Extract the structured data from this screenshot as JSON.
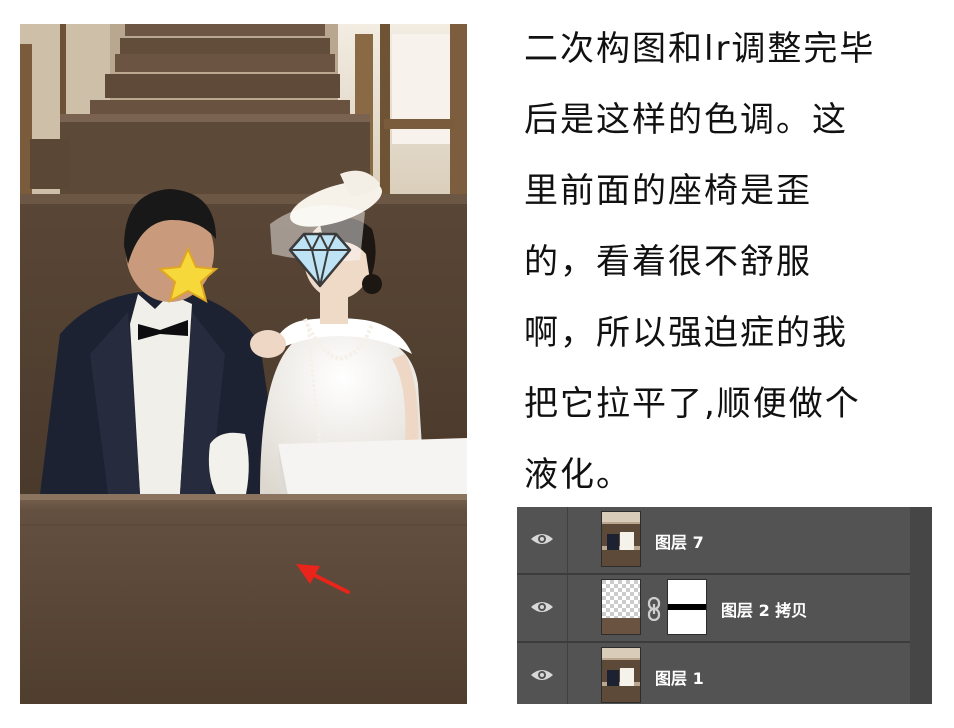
{
  "caption": {
    "lines": [
      "二次构图和lr调整完毕",
      "后是这样的色调。这",
      "里前面的座椅是歪",
      "的，看着很不舒服",
      "啊，所以强迫症的我",
      "把它拉平了,顺便做个",
      "液化。"
    ]
  },
  "layers": [
    {
      "name": "图层 7",
      "visible": true
    },
    {
      "name": "图层 2 拷贝",
      "visible": true,
      "has_mask": true
    },
    {
      "name": "图层 1",
      "visible": true
    }
  ],
  "colors": {
    "panel_bg": "#535353",
    "seat_brown": "#5d4937",
    "arrow_red": "#e8241b"
  },
  "icons": {
    "visibility": "eye-icon",
    "link": "chain-link-icon",
    "groom_face_cover": "star-icon",
    "bride_face_cover": "diamond-icon",
    "annotation": "red-arrow-icon"
  }
}
